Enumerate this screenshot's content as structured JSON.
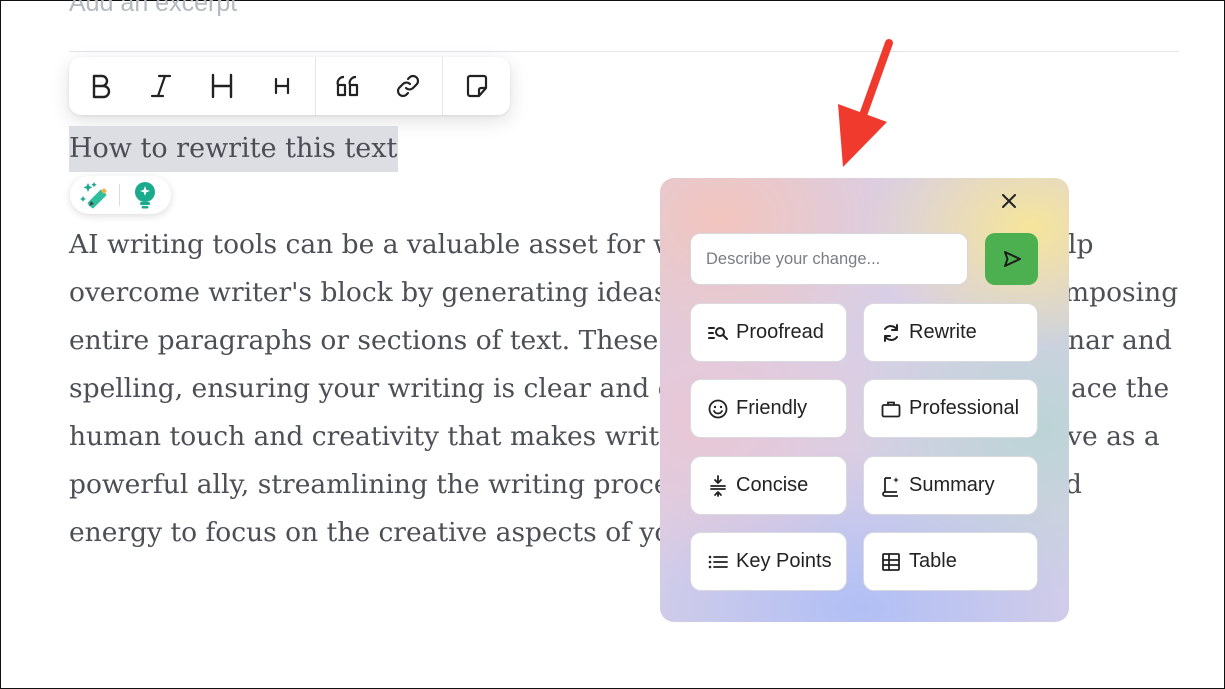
{
  "editor": {
    "excerpt_placeholder": "Add an excerpt",
    "selected_heading": "How to rewrite this text",
    "paragraph_lines": [
      {
        "text": "AI writing tools can be a valuable asset for w",
        "tail": "lp"
      },
      {
        "text": "overcome writer's block by generating ideas,",
        "tail": "mposing"
      },
      {
        "text": "entire paragraphs or sections of text. These t",
        "tail": "nar and"
      },
      {
        "text": "spelling, ensuring your writing is clear and e",
        "tail": "ace the"
      },
      {
        "text": "human touch and creativity that makes writi",
        "tail": "ve as a"
      },
      {
        "text": "powerful ally, streamlining the writing proce",
        "tail": "d"
      },
      {
        "text": "energy to focus on the creative aspects of you",
        "tail": ""
      }
    ]
  },
  "toolbar": {
    "icons": [
      "bold-icon",
      "italic-icon",
      "heading-icon",
      "small-heading-icon",
      "quote-icon",
      "link-icon",
      "note-icon"
    ]
  },
  "ai_panel": {
    "input_placeholder": "Describe your change...",
    "options": [
      {
        "label": "Proofread",
        "icon": "proofread-icon"
      },
      {
        "label": "Rewrite",
        "icon": "rewrite-icon"
      },
      {
        "label": "Friendly",
        "icon": "smiley-icon"
      },
      {
        "label": "Professional",
        "icon": "briefcase-icon"
      },
      {
        "label": "Concise",
        "icon": "compress-icon"
      },
      {
        "label": "Summary",
        "icon": "summary-icon"
      },
      {
        "label": "Key Points",
        "icon": "list-icon"
      },
      {
        "label": "Table",
        "icon": "table-icon"
      }
    ],
    "send_color": "#4caf50"
  },
  "annotation": {
    "arrow_color": "#f03a2e"
  }
}
